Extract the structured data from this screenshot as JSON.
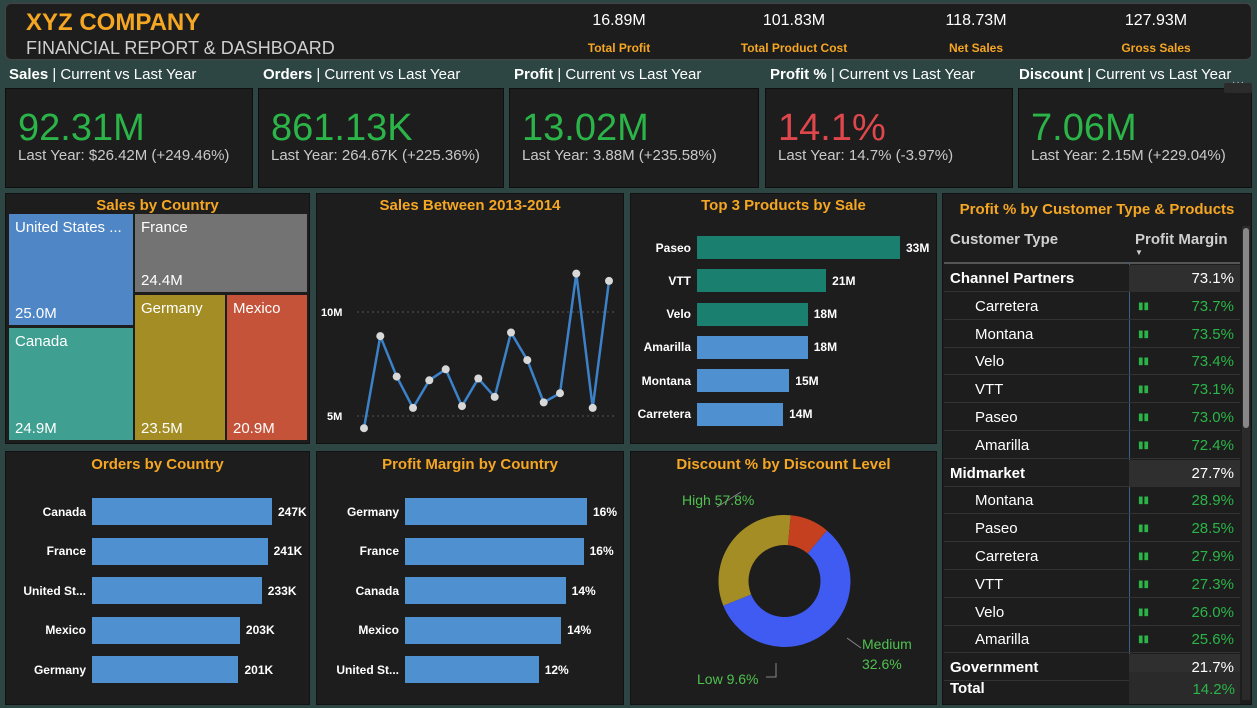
{
  "header": {
    "company": "XYZ COMPANY",
    "subtitle": "FINANCIAL REPORT & DASHBOARD",
    "stats": [
      {
        "value": "16.89M",
        "label": "Total Profit"
      },
      {
        "value": "101.83M",
        "label": "Total Product Cost"
      },
      {
        "value": "118.73M",
        "label": "Net Sales"
      },
      {
        "value": "127.93M",
        "label": "Gross Sales"
      }
    ]
  },
  "kpis": [
    {
      "name": "Sales",
      "suffix": " | Current vs Last Year",
      "value": "92.31M",
      "last_year": "Last Year: $26.42M (+249.46%)",
      "color": "#2bb548"
    },
    {
      "name": "Orders",
      "suffix": " | Current vs Last Year",
      "value": "861.13K",
      "last_year": "Last Year: 264.67K (+225.36%)",
      "color": "#2bb548"
    },
    {
      "name": "Profit",
      "suffix": " | Current vs Last Year",
      "value": "13.02M",
      "last_year": "Last Year: 3.88M (+235.58%)",
      "color": "#2bb548"
    },
    {
      "name": "Profit %",
      "suffix": " | Current vs Last Year",
      "value": "14.1%",
      "last_year": "Last Year: 14.7% (-3.97%)",
      "color": "#e0474c"
    },
    {
      "name": "Discount",
      "suffix": " | Current vs Last Year",
      "value": "7.06M",
      "last_year": "Last Year: 2.15M (+229.04%)",
      "color": "#2bb548"
    }
  ],
  "sales_by_country": {
    "title": "Sales by Country",
    "cells": [
      {
        "name": "United States ...",
        "value": "25.0M",
        "color": "#4f86c6"
      },
      {
        "name": "France",
        "value": "24.4M",
        "color": "#737373"
      },
      {
        "name": "Canada",
        "value": "24.9M",
        "color": "#3fa091"
      },
      {
        "name": "Germany",
        "value": "23.5M",
        "color": "#a58d25"
      },
      {
        "name": "Mexico",
        "value": "20.9M",
        "color": "#c4533a"
      }
    ]
  },
  "sales_trend": {
    "title": "Sales Between 2013-2014",
    "y_ticks": [
      "10M",
      "5M"
    ]
  },
  "top_products": {
    "title": "Top 3 Products by Sale",
    "items": [
      {
        "name": "Paseo",
        "label": "33M",
        "value": 33,
        "color": "#1a7f6e"
      },
      {
        "name": "VTT",
        "label": "21M",
        "value": 21,
        "color": "#1a7f6e"
      },
      {
        "name": "Velo",
        "label": "18M",
        "value": 18,
        "color": "#1a7f6e"
      },
      {
        "name": "Amarilla",
        "label": "18M",
        "value": 18,
        "color": "#4f90d1"
      },
      {
        "name": "Montana",
        "label": "15M",
        "value": 15,
        "color": "#4f90d1"
      },
      {
        "name": "Carretera",
        "label": "14M",
        "value": 14,
        "color": "#4f90d1"
      }
    ]
  },
  "orders_by_country": {
    "title": "Orders by Country",
    "items": [
      {
        "name": "Canada",
        "label": "247K",
        "value": 247
      },
      {
        "name": "France",
        "label": "241K",
        "value": 241
      },
      {
        "name": "United St...",
        "label": "233K",
        "value": 233
      },
      {
        "name": "Mexico",
        "label": "203K",
        "value": 203
      },
      {
        "name": "Germany",
        "label": "201K",
        "value": 201
      }
    ]
  },
  "profit_margin_by_country": {
    "title": "Profit Margin by Country",
    "items": [
      {
        "name": "Germany",
        "label": "16%",
        "value": 16.2
      },
      {
        "name": "France",
        "label": "16%",
        "value": 15.9
      },
      {
        "name": "Canada",
        "label": "14%",
        "value": 14.3
      },
      {
        "name": "Mexico",
        "label": "14%",
        "value": 13.9
      },
      {
        "name": "United St...",
        "label": "12%",
        "value": 11.9
      }
    ]
  },
  "discount_by_level": {
    "title": "Discount % by Discount Level",
    "high_label": "High 57.8%",
    "medium_label": "Medium",
    "medium_value": "32.6%",
    "low_label": "Low 9.6%"
  },
  "profit_table": {
    "title": "Profit % by Customer Type & Products",
    "col1": "Customer Type",
    "col2": "Profit Margin",
    "rows": [
      {
        "type": "group",
        "label": "Channel Partners",
        "value": "73.1%"
      },
      {
        "type": "child",
        "label": "Carretera",
        "value": "73.7%"
      },
      {
        "type": "child",
        "label": "Montana",
        "value": "73.5%"
      },
      {
        "type": "child",
        "label": "Velo",
        "value": "73.4%"
      },
      {
        "type": "child",
        "label": "VTT",
        "value": "73.1%"
      },
      {
        "type": "child",
        "label": "Paseo",
        "value": "73.0%"
      },
      {
        "type": "child",
        "label": "Amarilla",
        "value": "72.4%"
      },
      {
        "type": "group",
        "label": "Midmarket",
        "value": "27.7%"
      },
      {
        "type": "child",
        "label": "Montana",
        "value": "28.9%"
      },
      {
        "type": "child",
        "label": "Paseo",
        "value": "28.5%"
      },
      {
        "type": "child",
        "label": "Carretera",
        "value": "27.9%"
      },
      {
        "type": "child",
        "label": "VTT",
        "value": "27.3%"
      },
      {
        "type": "child",
        "label": "Velo",
        "value": "26.0%"
      },
      {
        "type": "child",
        "label": "Amarilla",
        "value": "25.6%"
      },
      {
        "type": "group",
        "label": "Government",
        "value": "21.7%"
      }
    ],
    "total_label": "Total",
    "total_value": "14.2%"
  },
  "chart_data": [
    {
      "type": "line",
      "title": "Sales Between 2013-2014",
      "y_ticks": [
        "10M",
        "5M"
      ],
      "ylim": [
        4.4,
        13.8
      ],
      "values": [
        4.5,
        9.5,
        7.3,
        5.6,
        7.1,
        7.7,
        5.7,
        7.2,
        6.2,
        9.7,
        8.2,
        5.9,
        6.4,
        12.9,
        5.6,
        12.5
      ]
    },
    {
      "type": "bar",
      "title": "Top 3 Products by Sale",
      "categories": [
        "Paseo",
        "VTT",
        "Velo",
        "Amarilla",
        "Montana",
        "Carretera"
      ],
      "values": [
        33,
        21,
        18,
        18,
        15,
        14
      ]
    },
    {
      "type": "bar",
      "title": "Orders by Country",
      "categories": [
        "Canada",
        "France",
        "United St...",
        "Mexico",
        "Germany"
      ],
      "values": [
        247,
        241,
        233,
        203,
        201
      ]
    },
    {
      "type": "bar",
      "title": "Profit Margin by Country",
      "categories": [
        "Germany",
        "France",
        "Canada",
        "Mexico",
        "United St..."
      ],
      "values": [
        16.2,
        15.9,
        14.3,
        13.9,
        11.9
      ]
    },
    {
      "type": "pie",
      "title": "Discount % by Discount Level",
      "categories": [
        "High",
        "Medium",
        "Low"
      ],
      "values": [
        57.8,
        32.6,
        9.6
      ],
      "colors": [
        "#3f5bf2",
        "#a58d25",
        "#c4401f"
      ]
    },
    {
      "type": "table",
      "title": "Sales by Country",
      "categories": [
        "United States",
        "France",
        "Canada",
        "Germany",
        "Mexico"
      ],
      "values": [
        25.0,
        24.4,
        24.9,
        23.5,
        20.9
      ]
    }
  ]
}
